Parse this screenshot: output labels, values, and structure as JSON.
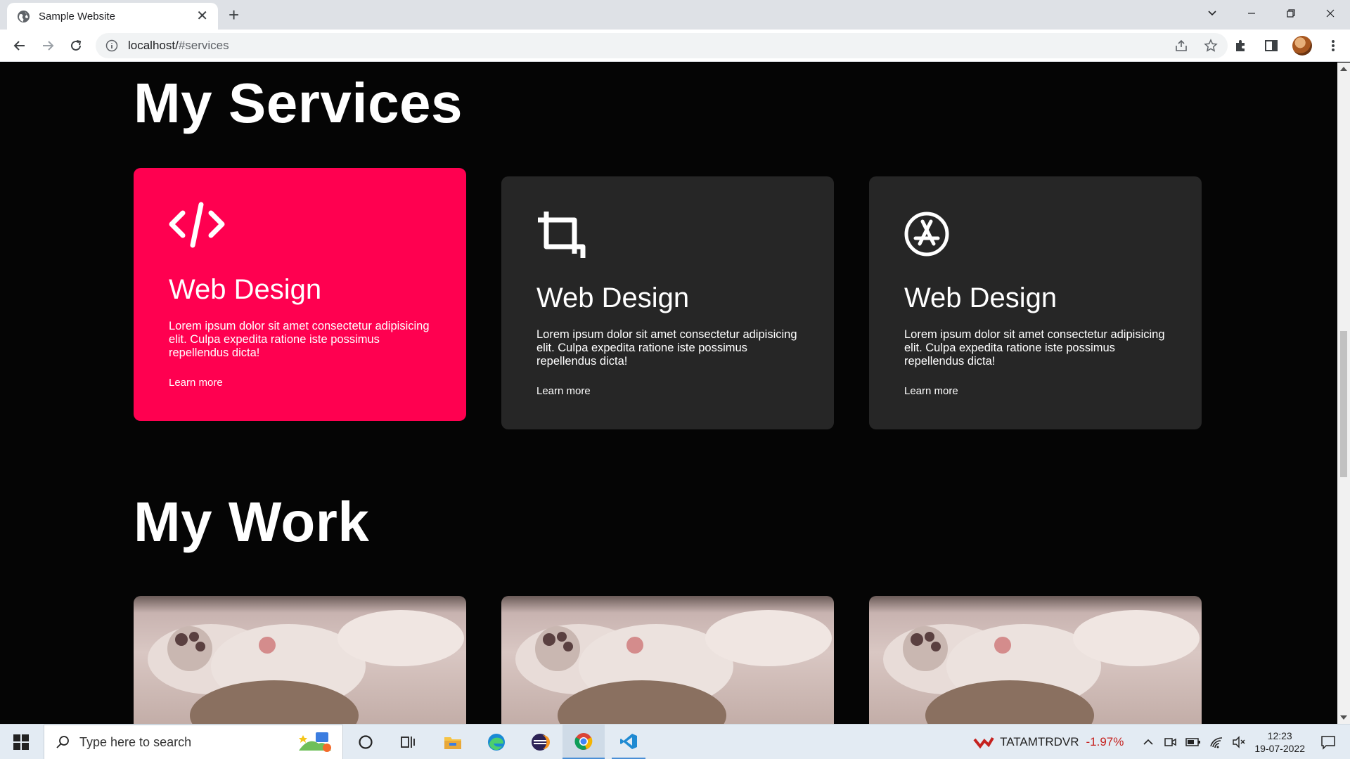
{
  "browser": {
    "tab_title": "Sample Website",
    "url_host": "localhost/",
    "url_path": "#services"
  },
  "page": {
    "services_title": "My Services",
    "work_title": "My Work",
    "cards": [
      {
        "icon": "code-icon",
        "title": "Web Design",
        "text": "Lorem ipsum dolor sit amet consectetur adipisicing elit. Culpa expedita ratione iste possimus repellendus dicta!",
        "link": "Learn more"
      },
      {
        "icon": "crop-icon",
        "title": "Web Design",
        "text": "Lorem ipsum dolor sit amet consectetur adipisicing elit. Culpa expedita ratione iste possimus repellendus dicta!",
        "link": "Learn more"
      },
      {
        "icon": "app-store-icon",
        "title": "Web Design",
        "text": "Lorem ipsum dolor sit amet consectetur adipisicing elit. Culpa expedita ratione iste possimus repellendus dicta!",
        "link": "Learn more"
      }
    ],
    "accent_color": "#ff0050",
    "card_color": "#262626"
  },
  "taskbar": {
    "search_placeholder": "Type here to search",
    "stock_name": "TATAMTRDVR",
    "stock_change": "-1.97%",
    "time": "12:23",
    "date": "19-07-2022"
  }
}
